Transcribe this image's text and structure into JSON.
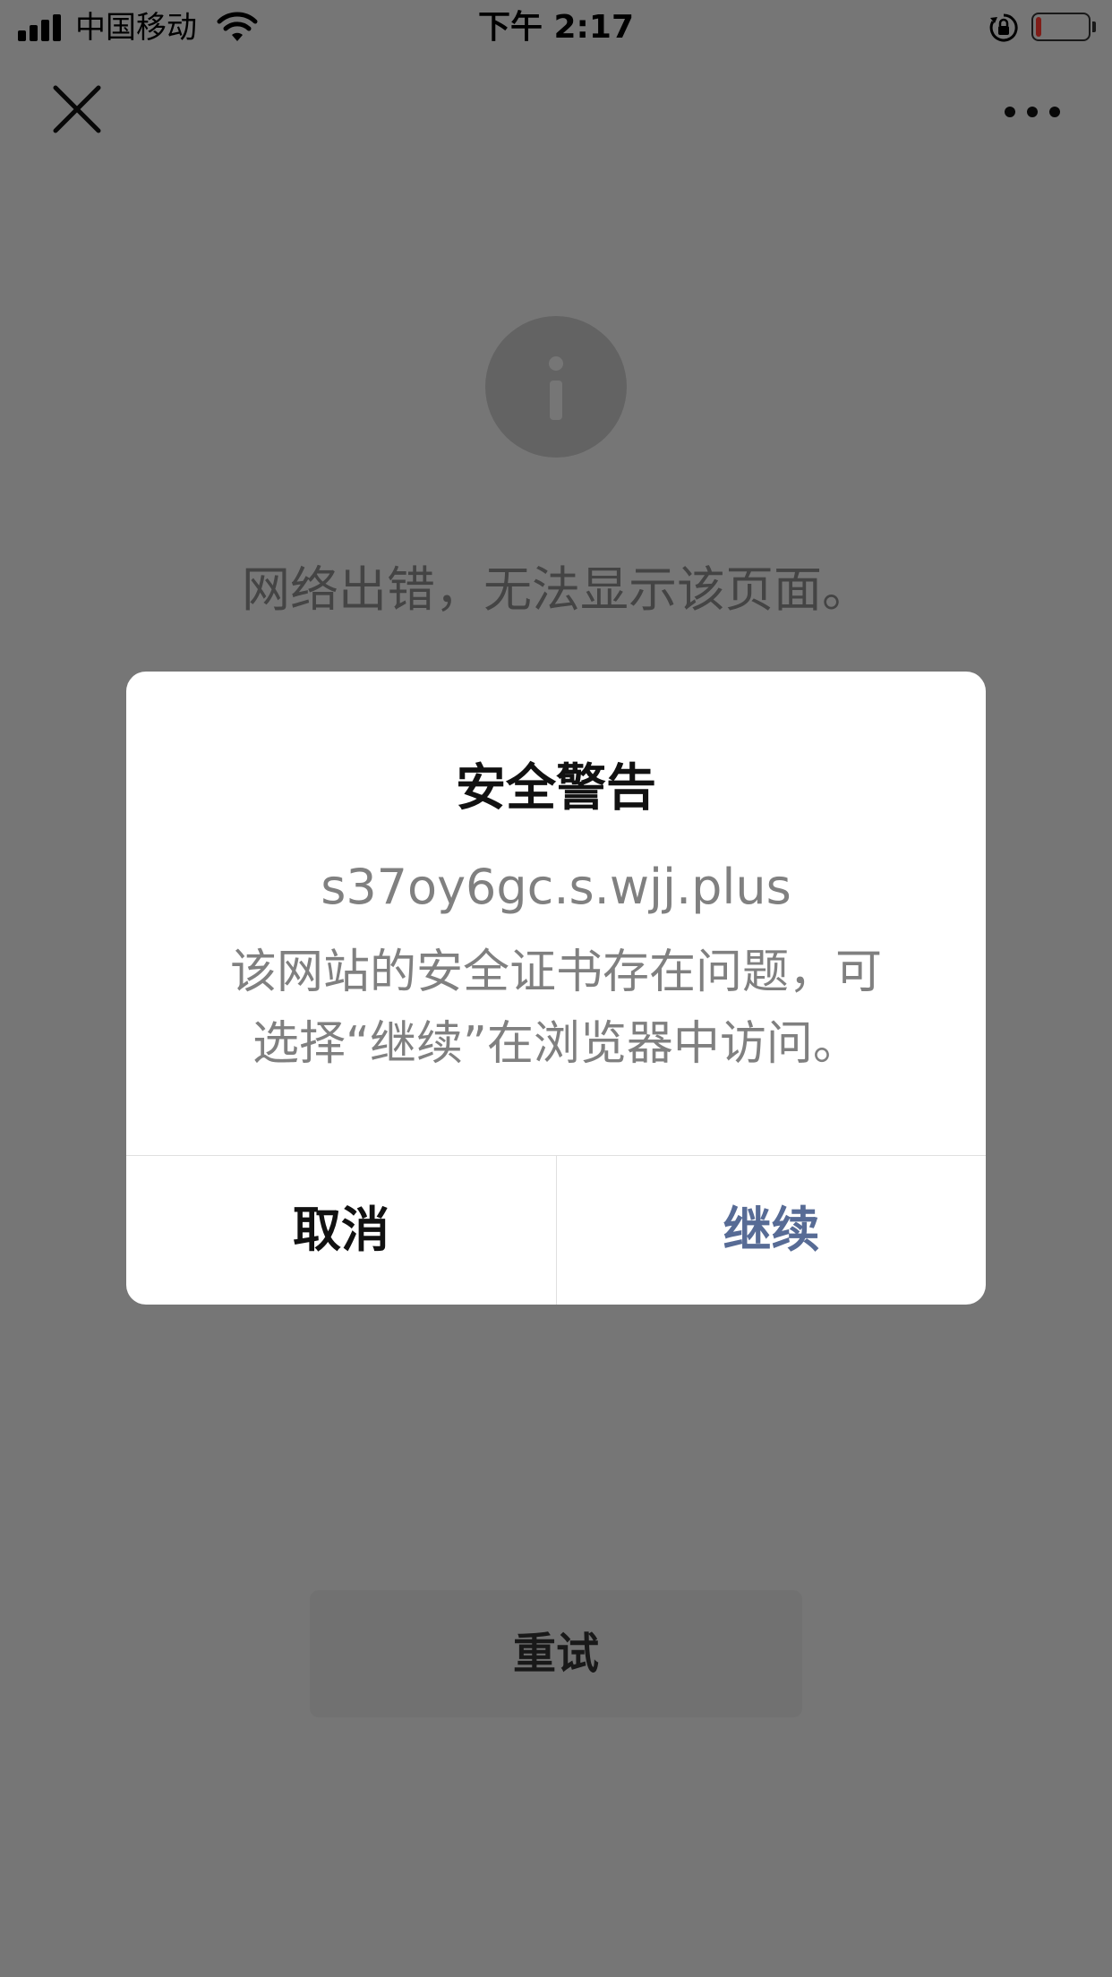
{
  "status_bar": {
    "carrier": "中国移动",
    "time": "下午 2:17",
    "battery_level": 0.1,
    "battery_color": "#ff3b30"
  },
  "nav": {
    "close_icon": "close-icon",
    "more_icon": "more-icon"
  },
  "page": {
    "info_icon": "info-icon",
    "error_message": "网络出错，无法显示该页面。",
    "retry_label": "重试"
  },
  "dialog": {
    "title": "安全警告",
    "url": "s37oy6gc.s.wjj.plus",
    "message_line1": "该网站的安全证书存在问题，可",
    "message_line2": "选择“继续”在浏览器中访问。",
    "cancel_label": "取消",
    "continue_label": "继续",
    "continue_color": "#576b95"
  }
}
